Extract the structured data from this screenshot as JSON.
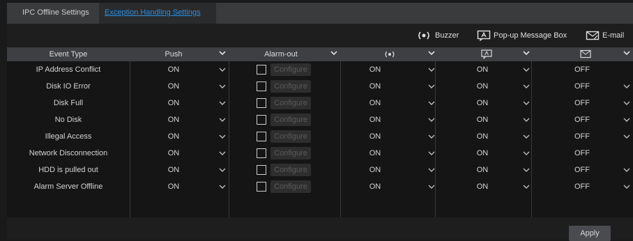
{
  "tabs": [
    "IPC Offline Settings",
    "Exception Handling Settings"
  ],
  "legend": {
    "buzzer": "Buzzer",
    "popup": "Pop-up Message Box",
    "email": "E-mail"
  },
  "headers": {
    "event_type": "Event Type",
    "push": "Push",
    "alarm_out": "Alarm-out"
  },
  "configure_label": "Configure",
  "rows": [
    {
      "event": "IP Address Conflict",
      "push": "ON",
      "buzzer": "ON",
      "popup": "ON",
      "email": "OFF",
      "email_dropdown": false
    },
    {
      "event": "Disk IO Error",
      "push": "ON",
      "buzzer": "ON",
      "popup": "ON",
      "email": "OFF",
      "email_dropdown": true
    },
    {
      "event": "Disk Full",
      "push": "ON",
      "buzzer": "ON",
      "popup": "ON",
      "email": "OFF",
      "email_dropdown": true
    },
    {
      "event": "No Disk",
      "push": "ON",
      "buzzer": "ON",
      "popup": "ON",
      "email": "OFF",
      "email_dropdown": true
    },
    {
      "event": "Illegal Access",
      "push": "ON",
      "buzzer": "ON",
      "popup": "ON",
      "email": "OFF",
      "email_dropdown": true
    },
    {
      "event": "Network Disconnection",
      "push": "ON",
      "buzzer": "ON",
      "popup": "ON",
      "email": "OFF",
      "email_dropdown": false
    },
    {
      "event": "HDD is pulled out",
      "push": "ON",
      "buzzer": "ON",
      "popup": "ON",
      "email": "OFF",
      "email_dropdown": true
    },
    {
      "event": "Alarm Server Offline",
      "push": "ON",
      "buzzer": "ON",
      "popup": "ON",
      "email": "OFF",
      "email_dropdown": true
    }
  ],
  "apply_label": "Apply",
  "colors": {
    "accent": "#2b8fe0",
    "header_bg": "#3d3f43",
    "tabbar_bg": "#3a3b3d"
  },
  "icons": [
    "buzzer-icon",
    "popup-message-icon",
    "email-icon",
    "chevron-down-icon"
  ]
}
